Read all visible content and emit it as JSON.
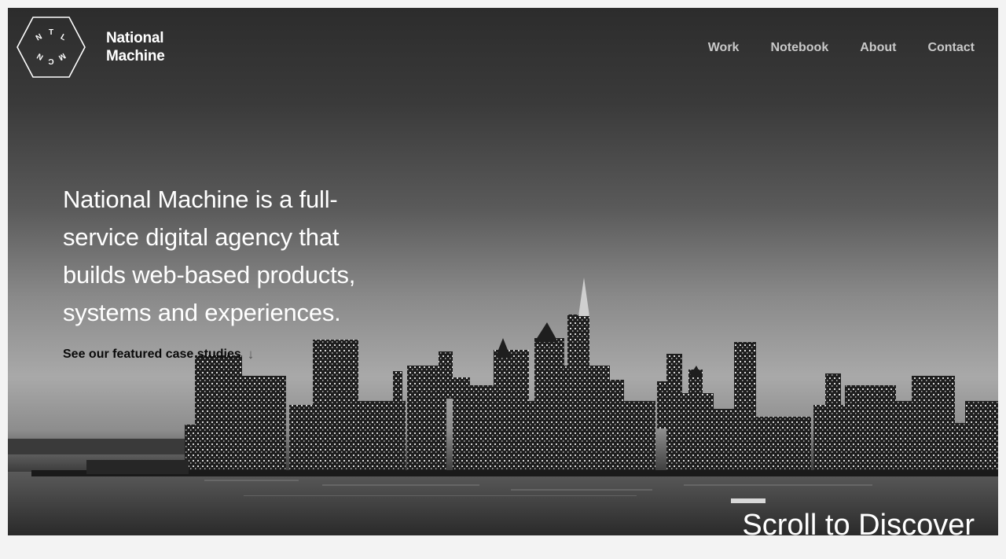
{
  "brand": {
    "name_line1": "National",
    "name_line2": "Machine",
    "mark_letters": [
      "N",
      "T",
      "L",
      "M",
      "C",
      "N"
    ]
  },
  "nav": {
    "items": [
      {
        "label": "Work"
      },
      {
        "label": "Notebook"
      },
      {
        "label": "About"
      },
      {
        "label": "Contact"
      }
    ]
  },
  "hero": {
    "headline": "National Machine is a full-service digital agency that builds web-based products, systems and experiences.",
    "cta_label": "See our featured case studies",
    "cta_icon": "arrow-down-icon"
  },
  "footer_cta": {
    "label": "Scroll to Discover"
  },
  "colors": {
    "page_background": "#f3f3f3",
    "text_primary": "#ffffff",
    "nav_text": "#c9c9c9",
    "cta_text": "#0a0a0a"
  }
}
